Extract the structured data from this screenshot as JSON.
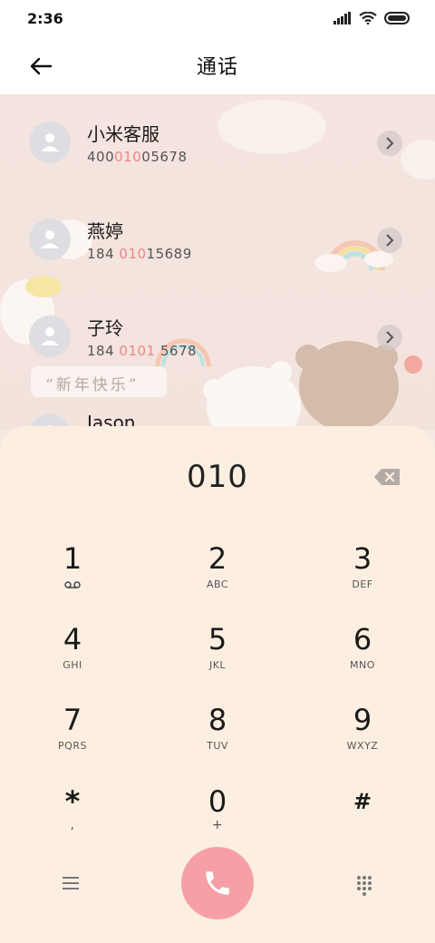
{
  "status_bar": {
    "time": "2:36"
  },
  "header": {
    "title": "通话"
  },
  "contacts": [
    {
      "name": "小米客服",
      "num_pre": "400",
      "num_hl": "010",
      "num_post": "05678"
    },
    {
      "name": "燕婷",
      "num_pre": "184 ",
      "num_hl": "010",
      "num_post": "15689"
    },
    {
      "name": "子玲",
      "num_pre": "184 ",
      "num_hl": "0101",
      "num_post": " 5678"
    },
    {
      "name": "Jason",
      "num_pre": "",
      "num_hl": "",
      "num_post": ""
    }
  ],
  "decor": {
    "sticker_text": "“新年快乐”"
  },
  "dialpad": {
    "dialed": "010",
    "keys": [
      {
        "digit": "1",
        "letters": ""
      },
      {
        "digit": "2",
        "letters": "ABC"
      },
      {
        "digit": "3",
        "letters": "DEF"
      },
      {
        "digit": "4",
        "letters": "GHI"
      },
      {
        "digit": "5",
        "letters": "JKL"
      },
      {
        "digit": "6",
        "letters": "MNO"
      },
      {
        "digit": "7",
        "letters": "PQRS"
      },
      {
        "digit": "8",
        "letters": "TUV"
      },
      {
        "digit": "9",
        "letters": "WXYZ"
      },
      {
        "digit": "*",
        "letters": ","
      },
      {
        "digit": "0",
        "letters": "+"
      },
      {
        "digit": "#",
        "letters": ""
      }
    ]
  },
  "colors": {
    "accent": "#f6a0a6",
    "highlight": "#e88886",
    "panel": "#fcefe1"
  },
  "icons": [
    "back-arrow-icon",
    "signal-icon",
    "wifi-icon",
    "battery-icon",
    "chevron-right-icon",
    "backspace-icon",
    "voicemail-icon",
    "menu-icon",
    "phone-icon",
    "dialpad-grid-icon"
  ]
}
